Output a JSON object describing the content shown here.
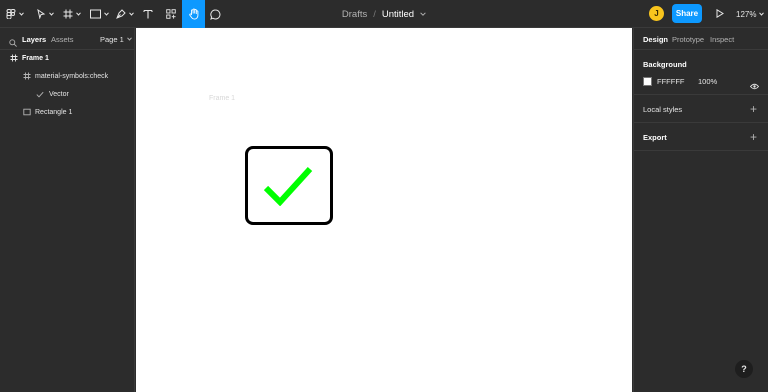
{
  "toolbar": {
    "tools": [
      "main-menu",
      "move",
      "frame",
      "rectangle",
      "pen",
      "text",
      "resources",
      "hand",
      "comment"
    ],
    "active_tool": "hand",
    "breadcrumb_parent": "Drafts",
    "breadcrumb_sep": "/",
    "file_name": "Untitled",
    "avatar_initial": "J",
    "share_label": "Share",
    "zoom_label": "127%"
  },
  "left_panel": {
    "tabs": [
      {
        "label": "Layers",
        "active": true
      },
      {
        "label": "Assets",
        "active": false
      }
    ],
    "page_selector": "Page 1",
    "layers": [
      {
        "name": "Frame 1",
        "icon": "frame-icon"
      },
      {
        "name": "material-symbols:check",
        "icon": "frame-icon"
      },
      {
        "name": "Vector",
        "icon": "check-vector-icon"
      },
      {
        "name": "Rectangle 1",
        "icon": "rectangle-icon"
      }
    ]
  },
  "canvas": {
    "frame_label": "Frame 1",
    "check_color": "#00ff00",
    "background": "#ffffff"
  },
  "right_panel": {
    "tabs": [
      {
        "label": "Design",
        "active": true
      },
      {
        "label": "Prototype",
        "active": false
      },
      {
        "label": "Inspect",
        "active": false
      }
    ],
    "background": {
      "title": "Background",
      "hex": "FFFFFF",
      "opacity": "100%"
    },
    "local_styles_label": "Local styles",
    "export_label": "Export"
  },
  "help_label": "?"
}
